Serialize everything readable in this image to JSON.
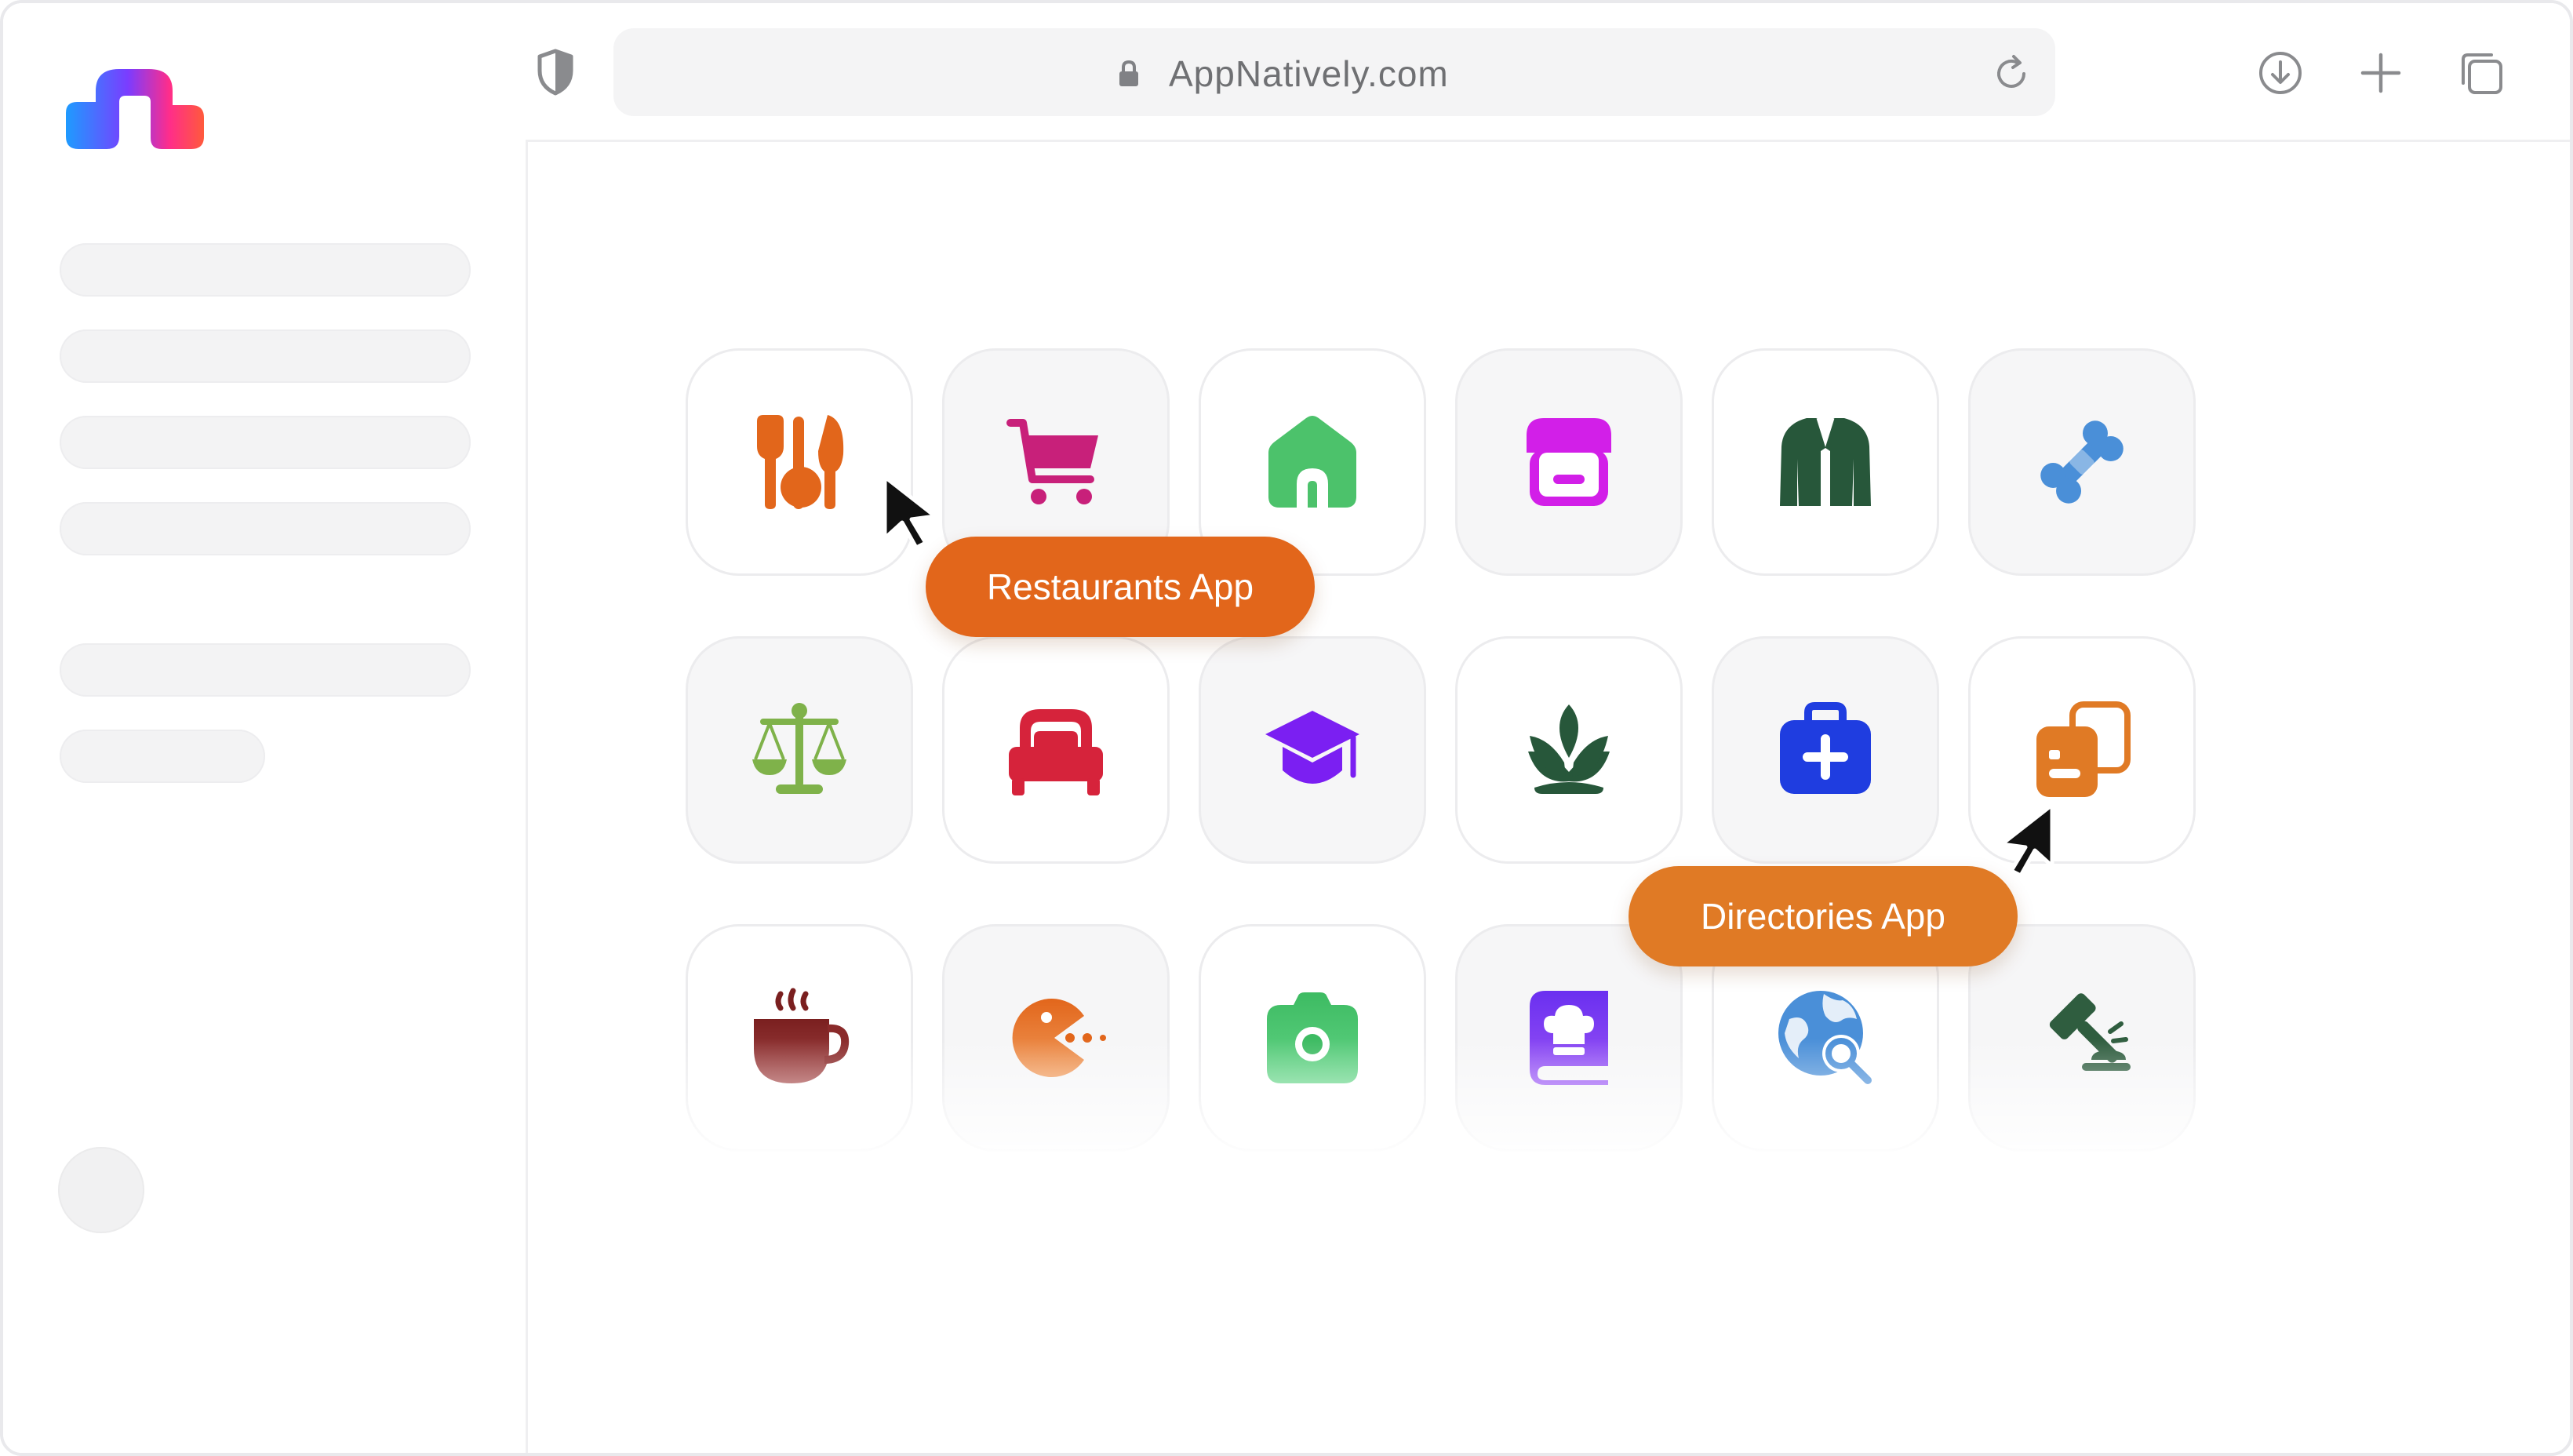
{
  "browser": {
    "url": "AppNatively.com",
    "icons": [
      "shield-icon",
      "lock-icon",
      "reload-icon",
      "download-icon",
      "new-tab-icon",
      "tabs-icon"
    ]
  },
  "sidebar": {
    "logo": "appnatively-logo",
    "placeholder_items": 6
  },
  "grid": {
    "rows": [
      [
        "restaurant-icon",
        "shopping-cart-icon",
        "home-icon",
        "store-icon",
        "jacket-icon",
        "bone-icon"
      ],
      [
        "scales-icon",
        "bed-icon",
        "graduation-cap-icon",
        "lotus-icon",
        "first-aid-kit-icon",
        "directory-cards-icon"
      ],
      [
        "coffee-cup-icon",
        "pacman-icon",
        "camera-icon",
        "cookbook-icon",
        "globe-search-icon",
        "gavel-icon"
      ]
    ]
  },
  "tooltips": {
    "restaurants": "Restaurants App",
    "directories": "Directories App"
  },
  "colors": {
    "restaurants_tooltip": "#e2661b",
    "directories_tooltip": "#e07a25"
  }
}
